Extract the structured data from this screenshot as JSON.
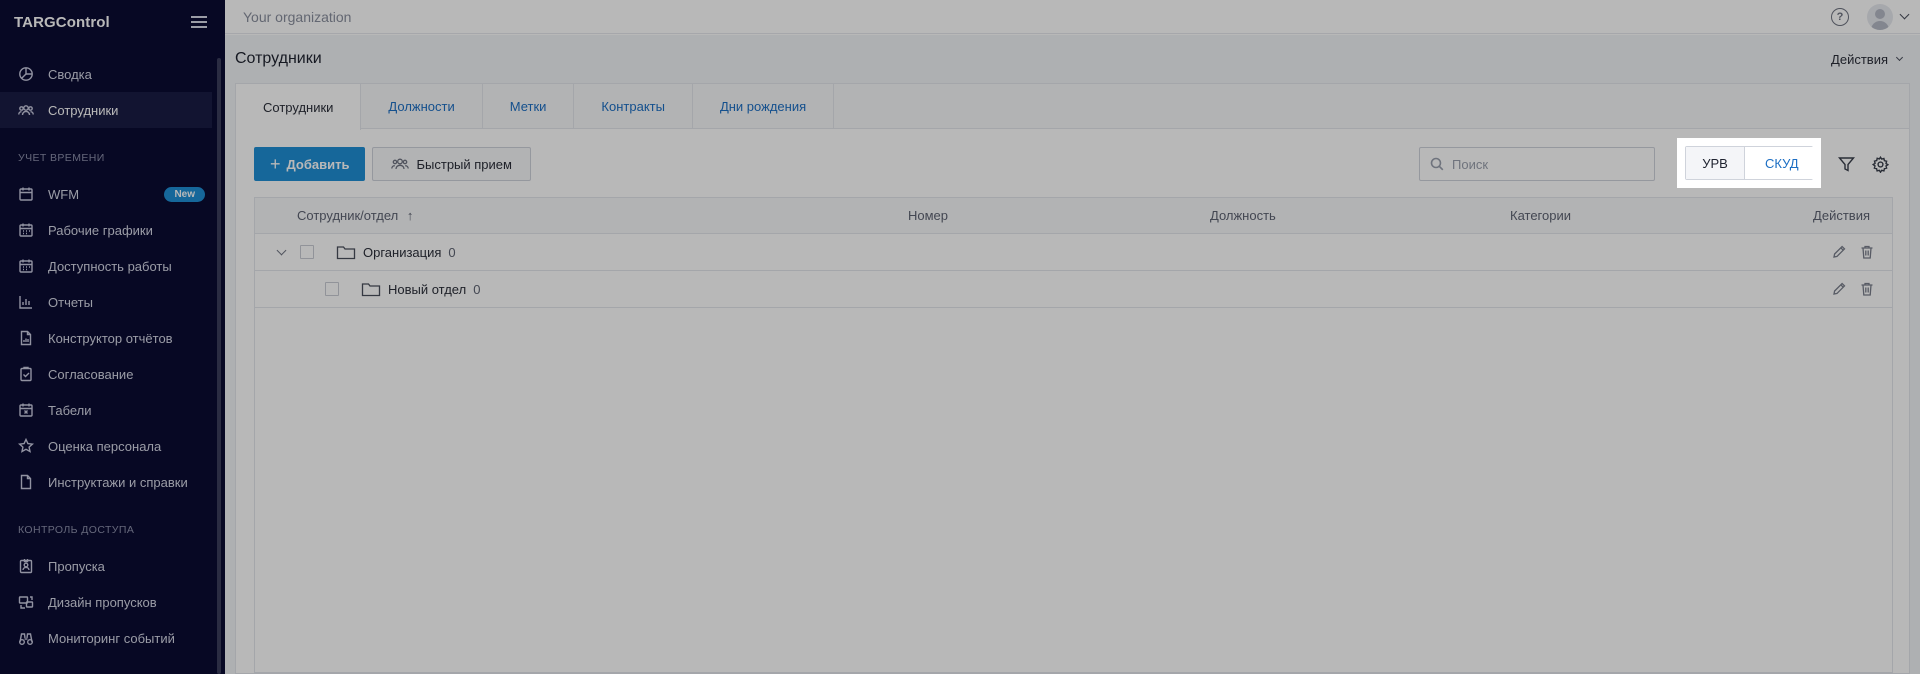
{
  "app": {
    "logo": "TARGControl"
  },
  "topbar": {
    "org_name": "Your organization",
    "help_glyph": "?"
  },
  "sidebar": {
    "items_top": [
      {
        "label": "Сводка",
        "icon": "chart-pie-icon"
      },
      {
        "label": "Сотрудники",
        "icon": "users-icon",
        "active": true
      }
    ],
    "section_time": "Учет времени",
    "items_time": [
      {
        "label": "WFM",
        "icon": "calendar-icon",
        "badge": "New"
      },
      {
        "label": "Рабочие графики",
        "icon": "calendar-grid-icon"
      },
      {
        "label": "Доступность работы",
        "icon": "calendar-grid-icon"
      },
      {
        "label": "Отчеты",
        "icon": "bar-chart-icon"
      },
      {
        "label": "Конструктор отчётов",
        "icon": "doc-chart-icon"
      },
      {
        "label": "Согласование",
        "icon": "clipboard-check-icon"
      },
      {
        "label": "Табели",
        "icon": "calendar-x-icon"
      },
      {
        "label": "Оценка персонала",
        "icon": "star-icon"
      },
      {
        "label": "Инструктажи и справки",
        "icon": "document-icon"
      }
    ],
    "section_access": "Контроль доступа",
    "items_access": [
      {
        "label": "Пропуска",
        "icon": "badge-icon"
      },
      {
        "label": "Дизайн пропусков",
        "icon": "design-icon"
      },
      {
        "label": "Мониторинг событий",
        "icon": "binoculars-icon"
      }
    ]
  },
  "page": {
    "title": "Сотрудники",
    "actions_label": "Действия"
  },
  "tabs": [
    {
      "label": "Сотрудники",
      "active": true
    },
    {
      "label": "Должности"
    },
    {
      "label": "Метки"
    },
    {
      "label": "Контракты"
    },
    {
      "label": "Дни рождения"
    }
  ],
  "toolbar": {
    "add_label": "Добавить",
    "add_glyph": "+",
    "quick_label": "Быстрый прием",
    "search_placeholder": "Поиск",
    "seg_urv": "УРВ",
    "seg_skud": "СКУД"
  },
  "table": {
    "columns": {
      "employee": "Сотрудник/отдел",
      "sort_glyph": "↑",
      "number": "Номер",
      "position": "Должность",
      "categories": "Категории",
      "actions": "Действия"
    },
    "rows": [
      {
        "name": "Организация",
        "count": "0"
      },
      {
        "name": "Новый отдел",
        "count": "0"
      }
    ]
  },
  "colors": {
    "sidebar_bg": "#0b0c33",
    "primary": "#1f8fd6",
    "link": "#1d6fc4"
  }
}
